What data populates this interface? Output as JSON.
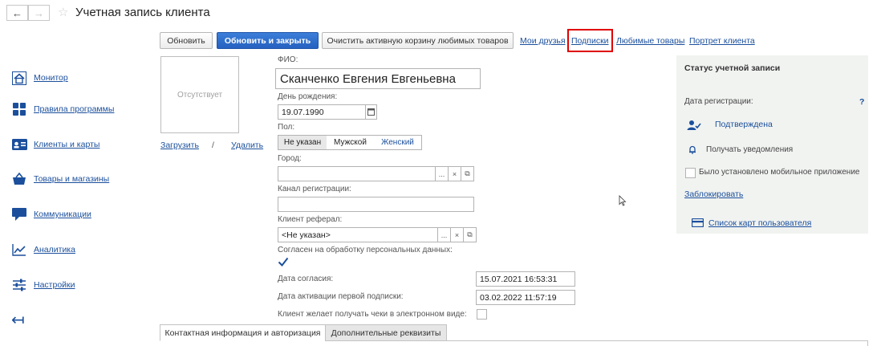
{
  "window": {
    "title": "Учетная запись клиента",
    "back_glyph": "←",
    "forward_glyph": "→",
    "star_glyph": "☆"
  },
  "toolbar": {
    "refresh_label": "Обновить",
    "refresh_close_label": "Обновить и закрыть",
    "clear_cart_label": "Очистить активную корзину любимых товаров",
    "links": [
      "Мои друзья",
      "Подписки",
      "Любимые товары",
      "Портрет клиента"
    ],
    "highlighted_link": "Подписки"
  },
  "sidebar": {
    "items": [
      {
        "label": "Монитор",
        "icon": "home-icon"
      },
      {
        "label": "Правила программы",
        "icon": "grid-icon"
      },
      {
        "label": "Клиенты и карты",
        "icon": "id-card-icon"
      },
      {
        "label": "Товары и магазины",
        "icon": "basket-icon"
      },
      {
        "label": "Коммуникации",
        "icon": "chat-icon"
      },
      {
        "label": "Аналитика",
        "icon": "chart-icon"
      },
      {
        "label": "Настройки",
        "icon": "sliders-icon"
      }
    ],
    "collapse_glyph": "↤"
  },
  "photo": {
    "placeholder": "Отсутствует",
    "upload_label": "Загрузить",
    "separator": "/",
    "delete_label": "Удалить"
  },
  "form": {
    "fio_label": "ФИО:",
    "fio_value": "Сканченко Евгения Евгеньевна",
    "birthday_label": "День рождения:",
    "birthday_value": "19.07.1990",
    "gender_label": "Пол:",
    "gender_options": [
      "Не указан",
      "Мужской",
      "Женский"
    ],
    "gender_selected": "Не указан",
    "city_label": "Город:",
    "city_value": "",
    "channel_label": "Канал регистрации:",
    "channel_value": "",
    "referral_label": "Клиент реферал:",
    "referral_value": "<Не указан>",
    "consent_label": "Согласен на обработку персональных данных:",
    "consent_checked": true,
    "consent_date_label": "Дата согласия:",
    "consent_date_value": "15.07.2021 16:53:31",
    "first_sub_label": "Дата активации первой подписки:",
    "first_sub_value": "03.02.2022 11:57:19",
    "receipts_label": "Клиент желает получать чеки в электронном виде:",
    "receipts_checked": false,
    "select_button": "...",
    "clear_button": "×",
    "open_button": "⧉"
  },
  "status_panel": {
    "title": "Статус учетной записи",
    "reg_date_label": "Дата регистрации:",
    "help_glyph": "?",
    "confirmed_label": "Подтверждена",
    "notify_label": "Получать уведомления",
    "mobile_app_label": "Было установлено мобильное приложение",
    "block_link": "Заблокировать",
    "cards_link": "Список карт пользователя"
  },
  "tabs": [
    "Контактная информация и авторизация",
    "Дополнительные реквизиты"
  ],
  "active_tab": "Контактная информация и авторизация",
  "colors": {
    "accent": "#2561c0",
    "link": "#1b4f9c",
    "highlight": "#e00000",
    "panel_bg": "#f1f3f1"
  }
}
